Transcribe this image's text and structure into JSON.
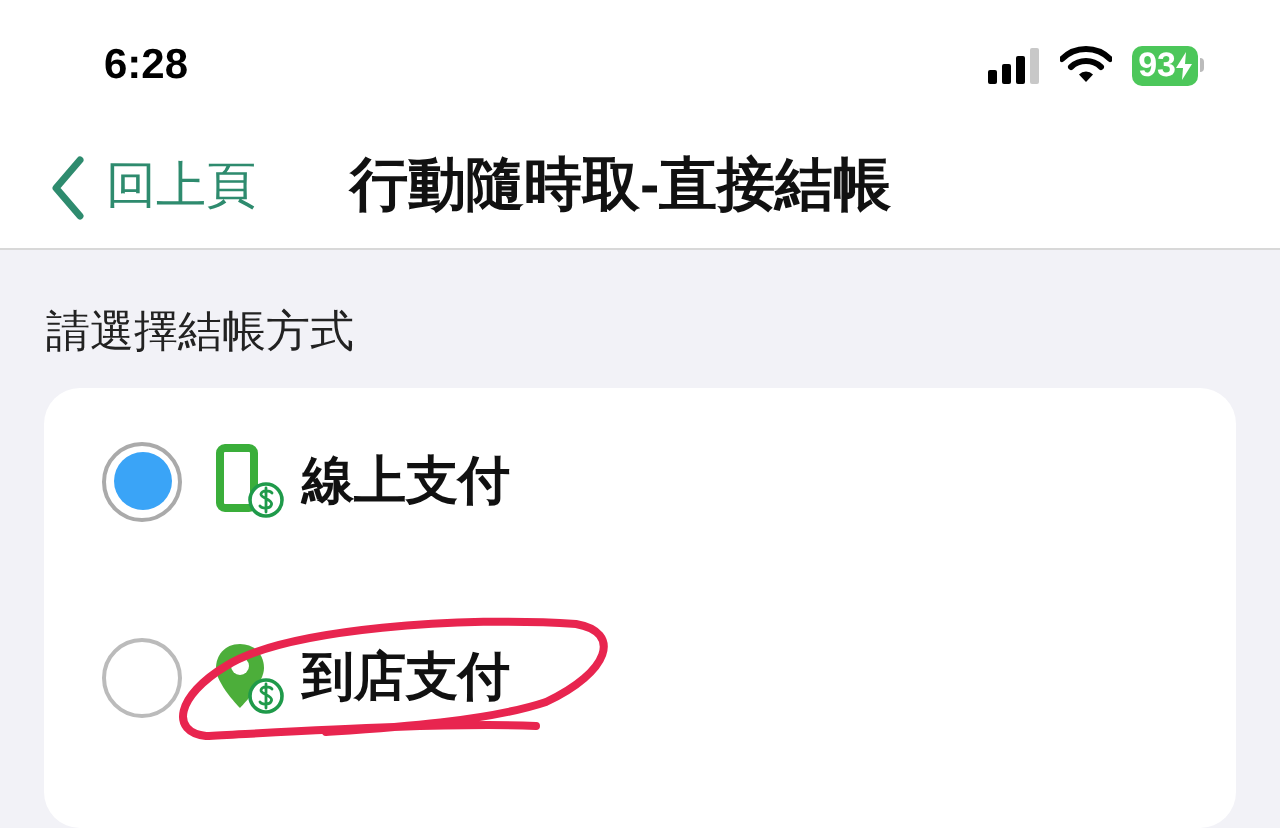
{
  "status_bar": {
    "time": "6:28",
    "battery": "93"
  },
  "nav_bar": {
    "back": "回上頁",
    "title": "行動隨時取-直接結帳"
  },
  "section_label": "請選擇結帳方式",
  "payment_options": [
    {
      "kind": "phone",
      "label": "線上支付",
      "selected": true,
      "circled": false
    },
    {
      "kind": "store",
      "label": "到店支付",
      "selected": false,
      "circled": true
    }
  ]
}
